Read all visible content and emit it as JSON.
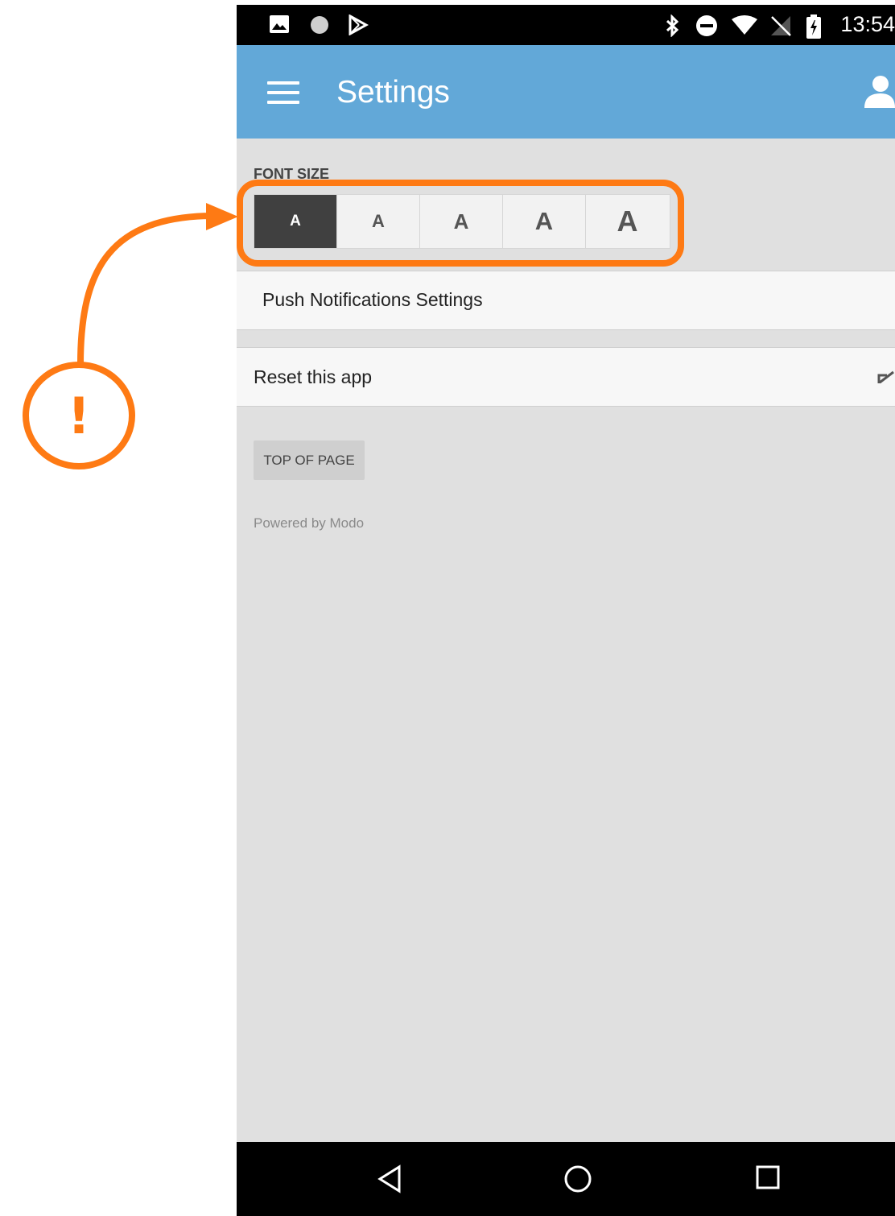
{
  "status_bar": {
    "time": "13:54",
    "left_icons": [
      "image-icon",
      "circle-icon",
      "play-store-icon"
    ],
    "right_icons": [
      "bluetooth-icon",
      "do-not-disturb-icon",
      "wifi-icon",
      "no-signal-icon",
      "battery-charging-icon"
    ]
  },
  "app_bar": {
    "title": "Settings",
    "menu_icon": "hamburger-menu-icon",
    "account_icon": "person-icon"
  },
  "font_size": {
    "label": "FONT SIZE",
    "options": [
      {
        "label": "A",
        "selected": true
      },
      {
        "label": "A",
        "selected": false
      },
      {
        "label": "A",
        "selected": false
      },
      {
        "label": "A",
        "selected": false
      },
      {
        "label": "A",
        "selected": false
      }
    ]
  },
  "rows": {
    "push_notifications": "Push Notifications Settings",
    "reset": "Reset this app"
  },
  "top_button": "TOP OF PAGE",
  "footer": "Powered by Modo",
  "nav_bar": {
    "icons": [
      "back-icon",
      "home-icon",
      "recents-icon"
    ]
  },
  "annotation": {
    "symbol": "!",
    "color": "#fe7a14"
  },
  "colors": {
    "app_bar": "#62a8d8",
    "selected_font_button": "#404040",
    "background": "#e0e0e0"
  }
}
